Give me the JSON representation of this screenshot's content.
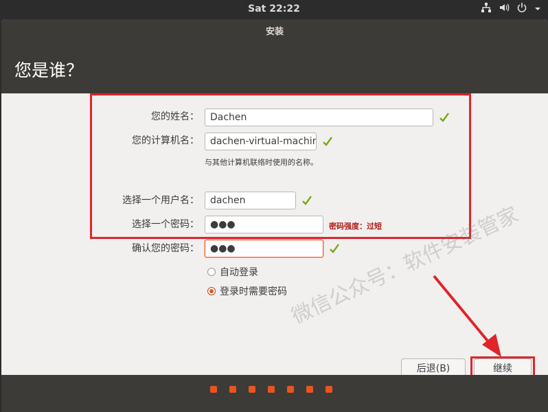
{
  "topbar": {
    "clock": "Sat 22:22"
  },
  "window": {
    "title": "安装",
    "page_title": "您是谁？"
  },
  "form": {
    "name_label": "您的姓名：",
    "name_value": "Dachen",
    "computer_label": "您的计算机名：",
    "computer_value": "dachen-virtual-machine",
    "computer_hint": "与其他计算机联络时使用的名称。",
    "username_label": "选择一个用户名：",
    "username_value": "dachen",
    "password_label": "选择一个密码：",
    "password_value": "●●●",
    "password_strength": "密码强度：过短",
    "confirm_label": "确认您的密码：",
    "confirm_value": "●●●"
  },
  "login_options": {
    "auto_login": "自动登录",
    "require_password": "登录时需要密码",
    "selected": "require_password"
  },
  "buttons": {
    "back": "后退(B)",
    "continue": "继续"
  },
  "progress": {
    "total_steps": 7
  },
  "watermark": "微信公众号：软件安装管家",
  "colors": {
    "accent": "#e95420",
    "annotation_red": "#e0242a",
    "check_green": "#7aa71c",
    "header_bg": "#3c3b37"
  }
}
